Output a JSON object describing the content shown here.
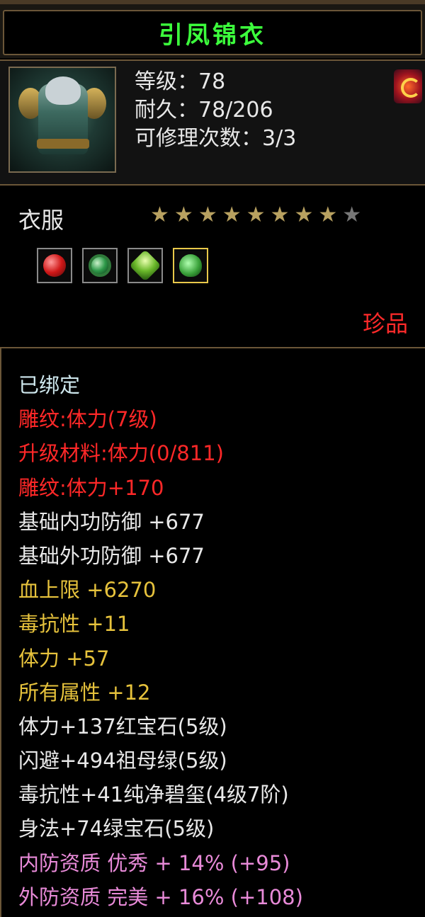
{
  "item": {
    "name": "引凤锦衣",
    "level_line": "等级：78",
    "durability_line": "耐久：78/206",
    "repair_line": "可修理次数：3/3",
    "type": "衣服",
    "stars_total": 9,
    "stars_filled": 8,
    "rarity": "珍品"
  },
  "gems": [
    {
      "icon": "red-gem-icon"
    },
    {
      "icon": "jade-ring-gem-icon"
    },
    {
      "icon": "green-gem-icon"
    },
    {
      "icon": "emerald-gem-icon",
      "selected": true
    }
  ],
  "attributes": {
    "bound": "已绑定",
    "carve_level": "雕纹:体力(7级)",
    "upgrade_material": "升级材料:体力(0/811)",
    "carve_bonus": "雕纹:体力+170",
    "base_inner_def": "基础内功防御 +677",
    "base_outer_def": "基础外功防御 +677",
    "hp_max": "血上限 +6270",
    "poison_resist": "毒抗性 +11",
    "stamina": "体力 +57",
    "all_attrs": "所有属性 +12",
    "gem_ruby": "体力+137红宝石(5级)",
    "gem_emerald": "闪避+494祖母绿(5级)",
    "gem_jade": "毒抗性+41纯净碧玺(4级7阶)",
    "gem_green": "身法+74绿宝石(5级)",
    "inner_quality": "内防资质 优秀 + 14% (+95)",
    "outer_quality": "外防资质 完美 + 16% (+108)"
  },
  "colors": {
    "title": "#3cff3c",
    "rarity": "#ff2a2a",
    "carve": "#ff2828",
    "bonus": "#e6c23c",
    "quality": "#e88ad8"
  }
}
